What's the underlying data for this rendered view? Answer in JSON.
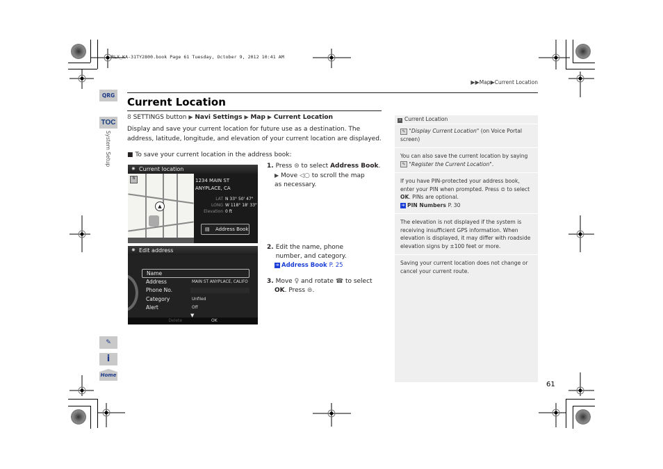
{
  "header_meta": "RLX_KA-31TY2800.book  Page 61  Tuesday, October 9, 2012  10:41 AM",
  "breadcrumb": [
    "Map",
    "Current Location"
  ],
  "side_tabs": {
    "qrg": "QRG",
    "toc": "TOC",
    "section": "System Setup",
    "home": "Home"
  },
  "page_title": "Current Location",
  "nav_path": {
    "start": "SETTINGS button",
    "steps": [
      "Navi Settings",
      "Map",
      "Current Location"
    ]
  },
  "intro": "Display and save your current location for future use as a destination. The address, latitude, longitude, and elevation of your current location are displayed.",
  "subheading": "To save your current location in the address book:",
  "screen1": {
    "title": "Current location",
    "address_line1": "1234 MAIN  ST",
    "address_line2": "ANYPLACE, CA",
    "lat_label": "LAT",
    "lat_value": "N 33° 50' 47\"",
    "long_label": "LONG",
    "long_value": "W 118° 18' 33\"",
    "elev_label": "Elevation",
    "elev_value": "0 ft",
    "button": "Address Book"
  },
  "screen2": {
    "title": "Edit address",
    "rows": [
      {
        "label": "Name",
        "value": ""
      },
      {
        "label": "Address",
        "value": "MAIN ST ANYPLACE, CALIFO"
      },
      {
        "label": "Phone No.",
        "value": ""
      },
      {
        "label": "Category",
        "value": "Unfiled"
      },
      {
        "label": "Alert",
        "value": "Off"
      }
    ],
    "footer_left": "Delete",
    "footer_ok": "OK"
  },
  "steps": {
    "s1_num": "1.",
    "s1_pre": "Press",
    "s1_mid": "to select",
    "s1_bold": "Address Book",
    "s1_sub_pre": "Move",
    "s1_sub_post": "to scroll the map as necessary.",
    "s2_num": "2.",
    "s2_text": "Edit the name, phone number, and category.",
    "s2_link": "Address Book",
    "s2_page": "P. 25",
    "s3_num": "3.",
    "s3_pre": "Move",
    "s3_mid": "and rotate",
    "s3_post": "to select",
    "s3_bold": "OK",
    "s3_end": ". Press"
  },
  "note": {
    "title": "Current Location",
    "voice_cmd1": "\"Display Current Location\"",
    "voice_cmd1_suffix": " (on Voice Portal screen)",
    "p2_pre": "You can also save the current location by saying",
    "voice_cmd2": "\"Register the Current Location\"",
    "p3_pre": "If you have PIN-protected your address book, enter your PIN when prompted. Press",
    "p3_mid": "to select",
    "p3_bold": "OK",
    "p3_post": ". PINs are optional.",
    "p3_link": "PIN Numbers",
    "p3_page": "P. 30",
    "p4": "The elevation is not displayed if the system is receiving insufficient GPS information. When elevation is displayed, it may differ with roadside elevation signs by ±100 feet or more.",
    "p5": "Saving your current location does not change or cancel your current route."
  },
  "page_number": "61",
  "colors": {
    "link": "#1c3fd8",
    "tab_bg": "#c9c9c9",
    "tab_text": "#1d3a8a",
    "note_bg": "#efefef"
  }
}
